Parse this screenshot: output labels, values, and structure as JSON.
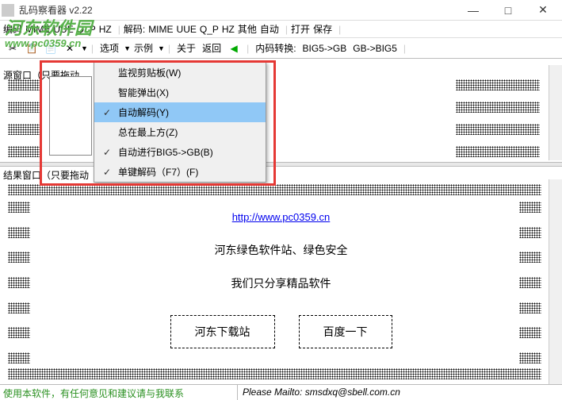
{
  "titlebar": {
    "title": "乱码察看器 v2.22"
  },
  "win": {
    "min": "—",
    "max": "□",
    "close": "✕"
  },
  "menubar": {
    "m1": "编码",
    "m2": "MIME",
    "m3": "UUE",
    "m4": "Q_P",
    "m5": "HZ",
    "decode": "解码:",
    "d1": "MIME",
    "d2": "UUE",
    "d3": "Q_P",
    "d4": "HZ",
    "d5": "其他",
    "d6": "自动",
    "open": "打开",
    "save": "保存"
  },
  "toolbar": {
    "t_view": "选项",
    "t_example": "示例",
    "t_about": "关于",
    "t_back": "返回",
    "t_convert": "内码转换:",
    "c1": "BIG5->GB",
    "c2": "GB->BIG5"
  },
  "watermark": {
    "line1": "河东软件园",
    "line2": "www.pc0359.cn"
  },
  "labels": {
    "source": "源窗口（只要拖动",
    "result": "结果窗口（只要拖动"
  },
  "menu": {
    "i1": "监视剪贴板(W)",
    "i2": "智能弹出(X)",
    "i3": "自动解码(Y)",
    "i4": "总在最上方(Z)",
    "i5": "自动进行BIG5->GB(B)",
    "i6": "单键解码（F7）(F)"
  },
  "content": {
    "link": "http://www.pc0359.cn",
    "text1": "河东绿色软件站、绿色安全",
    "text2": "我们只分享精品软件",
    "btn1": "河东下载站",
    "btn2": "百度一下"
  },
  "status": {
    "left": "使用本软件，有任何意见和建议请与我联系",
    "right": "Please Mailto: smsdxq@sbell.com.cn"
  }
}
